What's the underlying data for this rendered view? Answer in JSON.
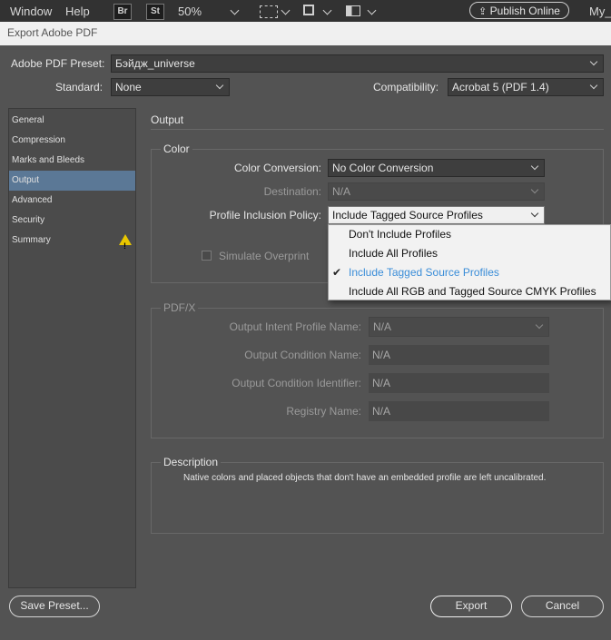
{
  "appbar": {
    "menu_window": "Window",
    "menu_help": "Help",
    "bridge_badge": "Br",
    "stock_badge": "St",
    "zoom": "50%",
    "publish_label": "Publish Online",
    "user_label": "My_"
  },
  "dialog": {
    "title": "Export Adobe PDF",
    "preset_label": "Adobe PDF Preset:",
    "preset_value": "Бэйдж_universe",
    "standard_label": "Standard:",
    "standard_value": "None",
    "compat_label": "Compatibility:",
    "compat_value": "Acrobat 5 (PDF 1.4)"
  },
  "sidebar": {
    "items": [
      {
        "label": "General"
      },
      {
        "label": "Compression"
      },
      {
        "label": "Marks and Bleeds"
      },
      {
        "label": "Output"
      },
      {
        "label": "Advanced"
      },
      {
        "label": "Security"
      },
      {
        "label": "Summary"
      }
    ],
    "selected": "Output",
    "warning_glyph": "!"
  },
  "output": {
    "section_title": "Output",
    "color": {
      "group_title": "Color",
      "conversion_label": "Color Conversion:",
      "conversion_value": "No Color Conversion",
      "destination_label": "Destination:",
      "destination_value": "N/A",
      "policy_label": "Profile Inclusion Policy:",
      "policy_value": "Include Tagged Source Profiles",
      "simulate_label": "Simulate Overprint"
    },
    "policy_options": [
      "Don't Include Profiles",
      "Include All Profiles",
      "Include Tagged Source Profiles",
      "Include All RGB and Tagged Source CMYK Profiles"
    ],
    "policy_checked_index": 2,
    "pdfx": {
      "group_title": "PDF/X",
      "intent_label": "Output Intent Profile Name:",
      "intent_value": "N/A",
      "condition_label": "Output Condition Name:",
      "condition_value": "N/A",
      "identifier_label": "Output Condition Identifier:",
      "identifier_value": "N/A",
      "registry_label": "Registry Name:",
      "registry_value": "N/A"
    },
    "description": {
      "group_title": "Description",
      "text": "Native colors and placed objects that don't have an embedded profile are left uncalibrated."
    }
  },
  "buttons": {
    "save_preset": "Save Preset...",
    "export": "Export",
    "cancel": "Cancel"
  },
  "colors": {
    "dialog_bg": "#535353",
    "selected_item": "#5b7896",
    "menu_active": "#3a8dd8",
    "warning": "#e8c600"
  }
}
